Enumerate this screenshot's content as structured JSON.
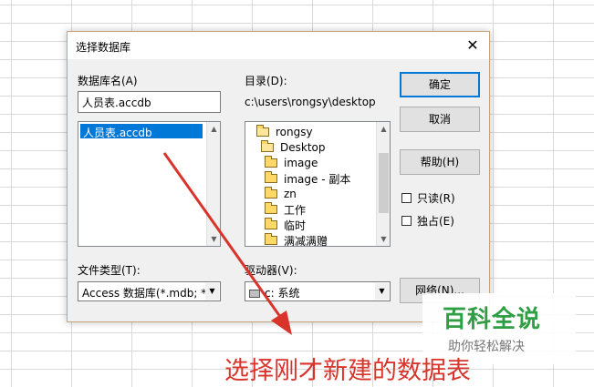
{
  "dialog": {
    "title": "选择数据库",
    "close_glyph": "✕",
    "db_name_label": "数据库名(A)",
    "db_name_value": "人员表.accdb",
    "db_files": [
      "人员表.accdb"
    ],
    "dir_label": "目录(D):",
    "dir_path": "c:\\users\\rongsy\\desktop",
    "dir_items": [
      {
        "name": "rongsy",
        "icon": "folder-open-icon"
      },
      {
        "name": "Desktop",
        "icon": "folder-open-icon"
      },
      {
        "name": "image",
        "icon": "folder-icon"
      },
      {
        "name": "image - 副本",
        "icon": "folder-icon"
      },
      {
        "name": "zn",
        "icon": "folder-icon"
      },
      {
        "name": "工作",
        "icon": "folder-icon"
      },
      {
        "name": "临时",
        "icon": "folder-icon"
      },
      {
        "name": "满减满赠",
        "icon": "folder-icon"
      }
    ],
    "file_type_label": "文件类型(T):",
    "file_type_value": "Access 数据库(*.mdb; *.",
    "drive_label": "驱动器(V):",
    "drive_value": "c: 系统",
    "buttons": {
      "ok": "确定",
      "cancel": "取消",
      "help": "帮助(H)",
      "network": "网络(N)..."
    },
    "readonly_label": "只读(R)",
    "exclusive_label": "独占(E)"
  },
  "watermark": {
    "title": "百科全说",
    "subtitle": "助你轻松解决"
  },
  "caption": "选择刚才新建的数据表",
  "colors": {
    "selection": "#0078d7",
    "arrow": "#d9342b",
    "watermark_green": "#2f9e44"
  }
}
